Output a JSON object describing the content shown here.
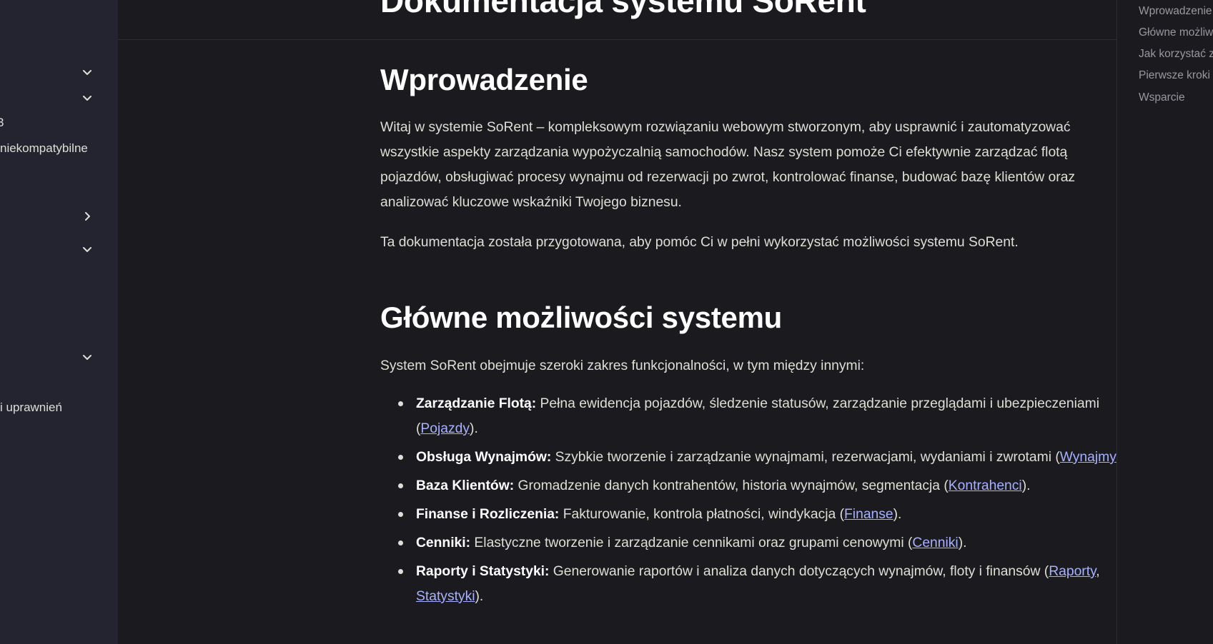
{
  "sidebar": {
    "items": [
      {
        "label": "",
        "chevron": "down"
      },
      {
        "label": "",
        "chevron": "down"
      },
      {
        "label": "3",
        "chevron": ""
      },
      {
        "label": " niekompatybilne",
        "chevron": ""
      },
      {
        "label": "",
        "chevron": "right"
      },
      {
        "label": "",
        "chevron": "down"
      },
      {
        "label": "",
        "chevron": "down"
      },
      {
        "label": "i uprawnień",
        "chevron": ""
      }
    ]
  },
  "main": {
    "title": "Dokumentacja systemu SoRent",
    "intro": {
      "heading": "Wprowadzenie",
      "p1": "Witaj w systemie SoRent – kompleksowym rozwiązaniu webowym stworzonym, aby usprawnić i zautomatyzować wszystkie aspekty zarządzania wypożyczalnią samochodów. Nasz system pomoże Ci efektywnie zarządzać flotą pojazdów, obsługiwać procesy wynajmu od rezerwacji po zwrot, kontrolować finanse, budować bazę klientów oraz analizować kluczowe wskaźniki Twojego biznesu.",
      "p2": "Ta dokumentacja została przygotowana, aby pomóc Ci w pełni wykorzystać możliwości systemu SoRent."
    },
    "features": {
      "heading": "Główne możliwości systemu",
      "lead": "System SoRent obejmuje szeroki zakres funkcjonalności, w tym między innymi:",
      "items": [
        {
          "title": "Zarządzanie Flotą:",
          "text": " Pełna ewidencja pojazdów, śledzenie statusów, zarządzanie przeglądami i ubezpieczeniami (",
          "link1": "Pojazdy",
          "sep": "",
          "link2": "",
          "end": ")."
        },
        {
          "title": "Obsługa Wynajmów:",
          "text": " Szybkie tworzenie i zarządzanie wynajmami, rezerwacjami, wydaniami i zwrotami (",
          "link1": "Wynajmy",
          "sep": "",
          "link2": "",
          "end": ")."
        },
        {
          "title": "Baza Klientów:",
          "text": " Gromadzenie danych kontrahentów, historia wynajmów, segmentacja (",
          "link1": "Kontrahenci",
          "sep": "",
          "link2": "",
          "end": ")."
        },
        {
          "title": "Finanse i Rozliczenia:",
          "text": " Fakturowanie, kontrola płatności, windykacja (",
          "link1": "Finanse",
          "sep": "",
          "link2": "",
          "end": ")."
        },
        {
          "title": "Cenniki:",
          "text": " Elastyczne tworzenie i zarządzanie cennikami oraz grupami cenowymi (",
          "link1": "Cenniki",
          "sep": "",
          "link2": "",
          "end": ")."
        },
        {
          "title": "Raporty i Statystyki:",
          "text": " Generowanie raportów i analiza danych dotyczących wynajmów, floty i finansów (",
          "link1": "Raporty",
          "sep": ", ",
          "link2": "Statystyki",
          "end": ")."
        }
      ]
    }
  },
  "toc": {
    "items": [
      "Wprowadzenie",
      "Główne możliwości systemu",
      "Jak korzystać z dokumentacji",
      "Pierwsze kroki",
      "Wsparcie"
    ]
  },
  "colors": {
    "background": "#1b1b1f",
    "sidebar": "#232430",
    "text": "#dfdfd6",
    "heading": "#ffffff",
    "link": "#a8b1ff",
    "toc_text": "#98989f"
  }
}
